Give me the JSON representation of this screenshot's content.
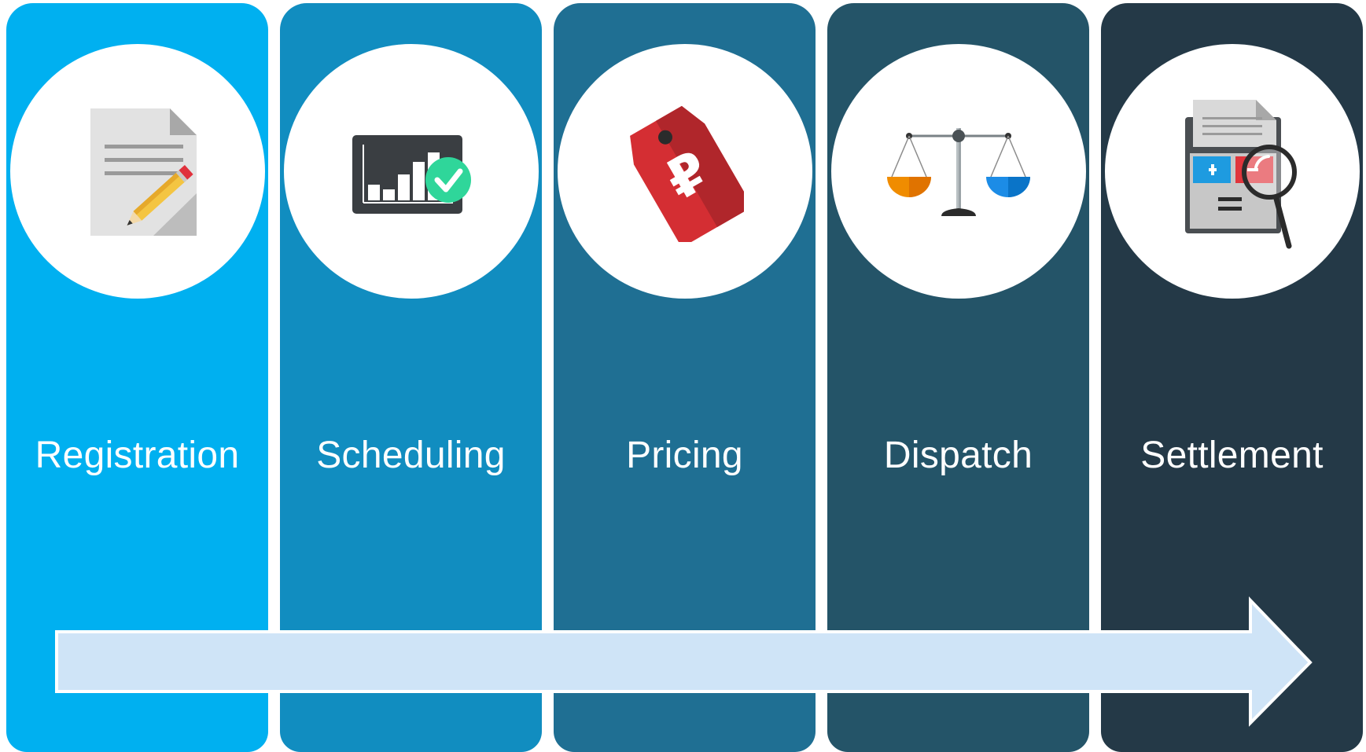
{
  "stages": [
    {
      "label": "Registration",
      "icon": "document-pencil-icon",
      "color": "#00B0F0"
    },
    {
      "label": "Scheduling",
      "icon": "bar-chart-check-icon",
      "color": "#118DC0"
    },
    {
      "label": "Pricing",
      "icon": "price-tag-icon",
      "color": "#1F6F93"
    },
    {
      "label": "Dispatch",
      "icon": "balance-scale-icon",
      "color": "#245468"
    },
    {
      "label": "Settlement",
      "icon": "calculator-magnifier-icon",
      "color": "#243947"
    }
  ],
  "flow_arrow": {
    "color": "#CFE4F7",
    "direction": "left-to-right"
  }
}
